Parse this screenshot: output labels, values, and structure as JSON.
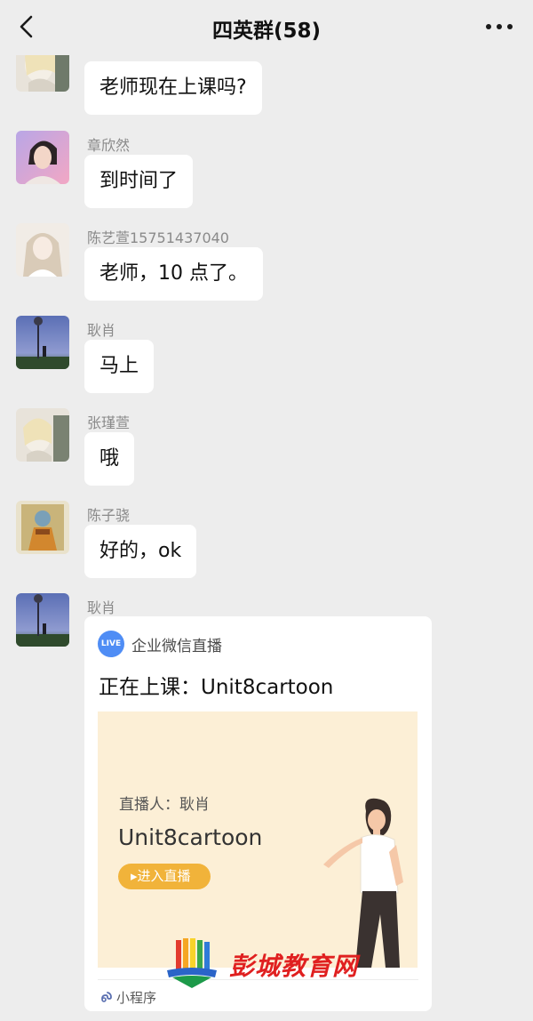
{
  "header": {
    "title": "四英群(58)",
    "back_icon": "chevron-left-icon",
    "more_icon": "more-dots-icon"
  },
  "messages": [
    {
      "sender": "",
      "text": "老师现在上课吗?"
    },
    {
      "sender": "章欣然",
      "text": "到时间了"
    },
    {
      "sender": "陈艺萱15751437040",
      "text": "老师，10 点了。"
    },
    {
      "sender": "耿肖",
      "text": "马上"
    },
    {
      "sender": "张瑾萱",
      "text": "哦"
    },
    {
      "sender": "陈子骁",
      "text": "好的，ok"
    }
  ],
  "live_message": {
    "sender": "耿肖",
    "badge": "LIVE",
    "provider": "企业微信直播",
    "title": "正在上课：Unit8cartoon",
    "cover": {
      "host": "直播人：耿肖",
      "title": "Unit8cartoon",
      "button": "进入直播"
    },
    "footer": "小程序"
  },
  "watermark": {
    "text": "彭城教育网"
  },
  "colors": {
    "background": "#ededed",
    "bubble": "#ffffff",
    "live_badge": "#4f8df5",
    "cover_bg": "#fcefd6",
    "enter_button": "#f1b33a",
    "watermark_text": "#e02020"
  }
}
